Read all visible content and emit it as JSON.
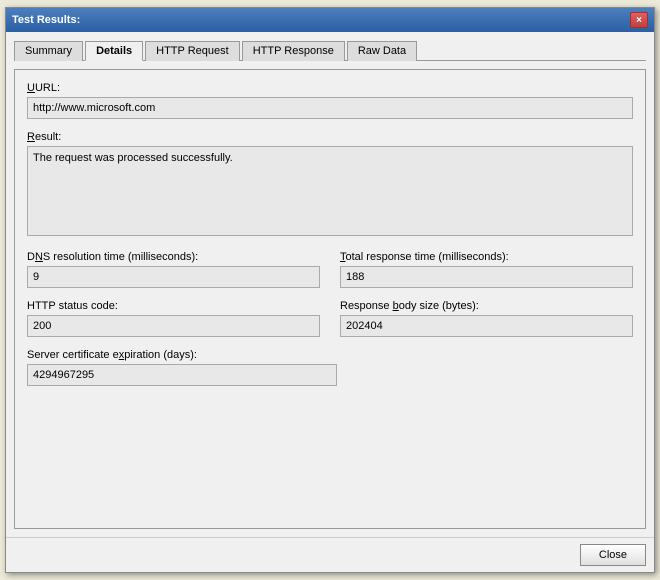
{
  "window": {
    "title": "Test Results:",
    "close_icon": "×"
  },
  "tabs": [
    {
      "label": "Summary",
      "active": false
    },
    {
      "label": "Details",
      "active": true
    },
    {
      "label": "HTTP Request",
      "active": false
    },
    {
      "label": "HTTP Response",
      "active": false
    },
    {
      "label": "Raw Data",
      "active": false
    }
  ],
  "fields": {
    "url_label": "URL:",
    "url_value": "http://www.microsoft.com",
    "result_label": "Result:",
    "result_value": "The request was processed successfully.",
    "dns_label": "DNS resolution time (milliseconds):",
    "dns_value": "9",
    "total_response_label": "Total response time (milliseconds):",
    "total_response_value": "188",
    "http_status_label": "HTTP status code:",
    "http_status_value": "200",
    "response_body_label": "Response body size (bytes):",
    "response_body_value": "202404",
    "cert_expiry_label": "Server certificate expiration (days):",
    "cert_expiry_value": "4294967295"
  },
  "buttons": {
    "close_label": "Close"
  }
}
